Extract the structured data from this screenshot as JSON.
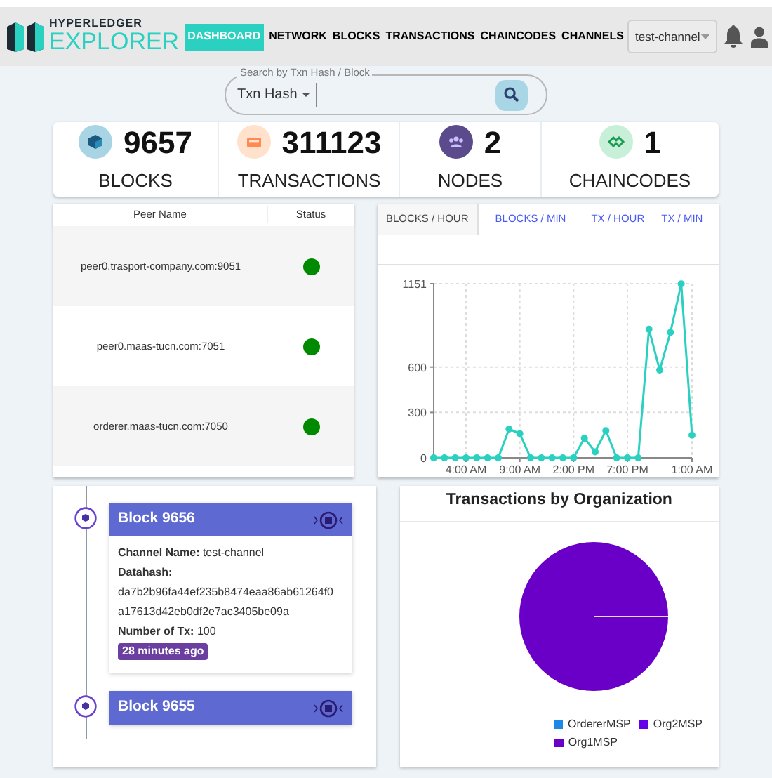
{
  "header": {
    "logo_top": "HYPERLEDGER",
    "logo_bottom": "EXPLORER",
    "nav": [
      {
        "label": "DASHBOARD",
        "selected": true
      },
      {
        "label": "NETWORK",
        "selected": false
      },
      {
        "label": "BLOCKS",
        "selected": false
      },
      {
        "label": "TRANSACTIONS",
        "selected": false
      },
      {
        "label": "CHAINCODES",
        "selected": false
      },
      {
        "label": "CHANNELS",
        "selected": false
      }
    ],
    "channel_select": "test-channel"
  },
  "search": {
    "legend": "Search by Txn Hash / Block",
    "type_select": "Txn Hash"
  },
  "stats": [
    {
      "kind": "blocks",
      "value": "9657",
      "label": "BLOCKS"
    },
    {
      "kind": "transactions",
      "value": "311123",
      "label": "TRANSACTIONS"
    },
    {
      "kind": "nodes",
      "value": "2",
      "label": "NODES"
    },
    {
      "kind": "chaincodes",
      "value": "1",
      "label": "CHAINCODES"
    }
  ],
  "peers": {
    "columns": [
      "Peer Name",
      "Status"
    ],
    "rows": [
      {
        "name": "peer0.trasport-company.com:9051",
        "color": "#008a00"
      },
      {
        "name": "peer0.maas-tucn.com:7051",
        "color": "#008a00"
      },
      {
        "name": "orderer.maas-tucn.com:7050",
        "color": "#008a00"
      }
    ]
  },
  "activity": {
    "tabs": [
      {
        "label": "BLOCKS / HOUR",
        "selected": true
      },
      {
        "label": "BLOCKS / MIN",
        "selected": false
      },
      {
        "label": "TX / HOUR",
        "selected": false
      },
      {
        "label": "TX / MIN",
        "selected": false
      }
    ],
    "chart_data": {
      "type": "line",
      "categories": [
        null,
        null,
        null,
        "4:00 AM",
        null,
        null,
        null,
        null,
        "9:00 AM",
        null,
        null,
        null,
        null,
        "2:00 PM",
        null,
        null,
        null,
        null,
        "7:00 PM",
        null,
        null,
        null,
        null,
        null,
        "1:00 AM"
      ],
      "grid": true,
      "series": [
        {
          "color": "#2ad0c0",
          "marker": true,
          "values": [
            0,
            0,
            0,
            0,
            0,
            0,
            0,
            190,
            160,
            0,
            0,
            0,
            0,
            0,
            130,
            40,
            180,
            0,
            0,
            0,
            850,
            580,
            830,
            1150,
            150
          ]
        }
      ],
      "yticks": [
        0,
        300,
        600,
        1151
      ],
      "ylim": [
        0,
        1151
      ]
    }
  },
  "blocks": [
    {
      "title": "Block 9656",
      "expanded": true,
      "channel": "**Channel Name:** test-channel",
      "datahash_label": "Datahash:",
      "datahash": "da7b2b96fa44ef235b8474eaa86ab61264f0a17613d42eb0df2e7ac3405be09a",
      "tx": "**Number of Tx:** 100",
      "age": "28 minutes ago"
    },
    {
      "title": "Block 9655",
      "expanded": false
    }
  ],
  "organizations": {
    "title": "Transactions by Organization",
    "legend": [
      {
        "label": "OrdererMSP",
        "color": "#1e88e5"
      },
      {
        "label": "Org2MSP",
        "color": "#6200ea"
      },
      {
        "label": "Org1MSP",
        "color": "#6a00c8"
      }
    ]
  }
}
